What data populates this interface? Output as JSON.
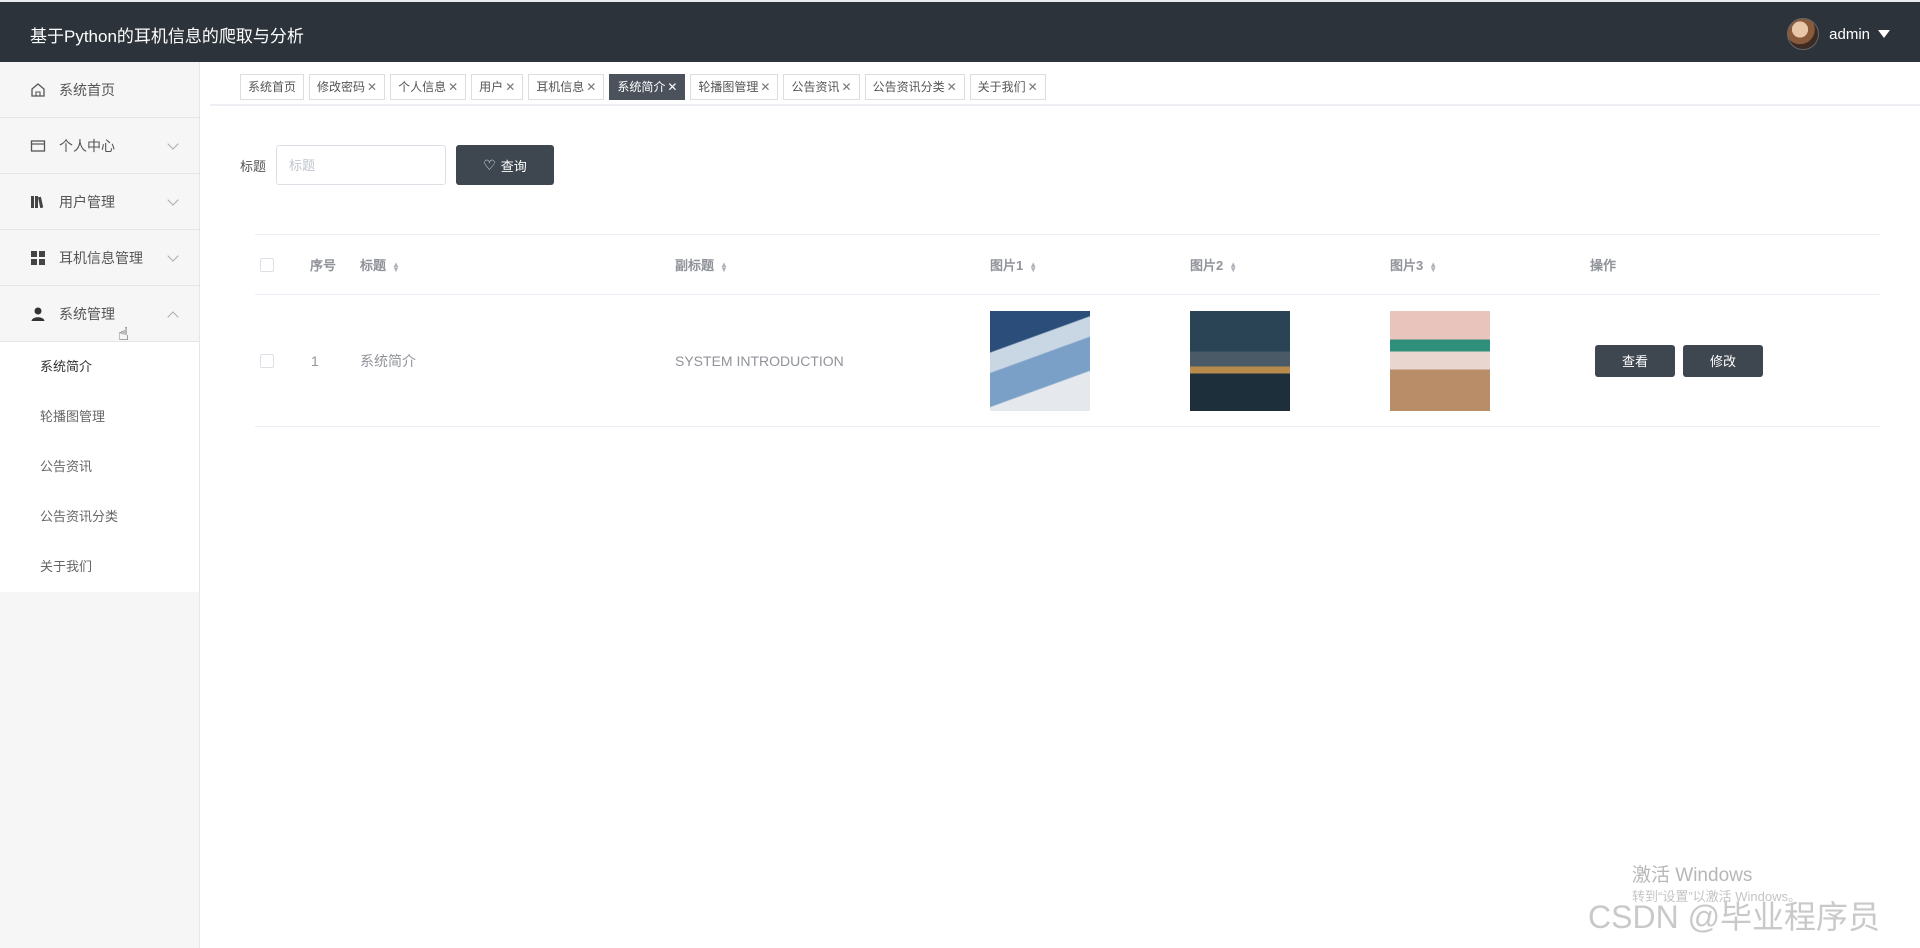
{
  "header": {
    "title": "基于Python的耳机信息的爬取与分析",
    "user": "admin"
  },
  "sidebar": {
    "items": [
      {
        "label": "系统首页",
        "icon": "home-icon"
      },
      {
        "label": "个人中心",
        "icon": "wallet-icon"
      },
      {
        "label": "用户管理",
        "icon": "books-icon"
      },
      {
        "label": "耳机信息管理",
        "icon": "grid-icon"
      },
      {
        "label": "系统管理",
        "icon": "person-icon"
      }
    ],
    "submenu": [
      "系统简介",
      "轮播图管理",
      "公告资讯",
      "公告资讯分类",
      "关于我们"
    ]
  },
  "tabs": [
    "系统首页",
    "修改密码",
    "个人信息",
    "用户",
    "耳机信息",
    "系统简介",
    "轮播图管理",
    "公告资讯",
    "公告资讯分类",
    "关于我们"
  ],
  "active_tab": "系统简介",
  "search": {
    "label": "标题",
    "placeholder": "标题",
    "button": "查询"
  },
  "table": {
    "headers": {
      "index": "序号",
      "title": "标题",
      "subtitle": "副标题",
      "img1": "图片1",
      "img2": "图片2",
      "img3": "图片3",
      "ops": "操作"
    },
    "rows": [
      {
        "index": "1",
        "title": "系统简介",
        "subtitle": "SYSTEM INTRODUCTION",
        "view": "查看",
        "edit": "修改"
      }
    ]
  },
  "watermark": {
    "line1": "激活 Windows",
    "line2": "转到“设置”以激活 Windows。",
    "csdn": "CSDN @毕业程序员"
  },
  "colors": {
    "header_bg": "#2c333b",
    "button_bg": "#3e4650"
  }
}
